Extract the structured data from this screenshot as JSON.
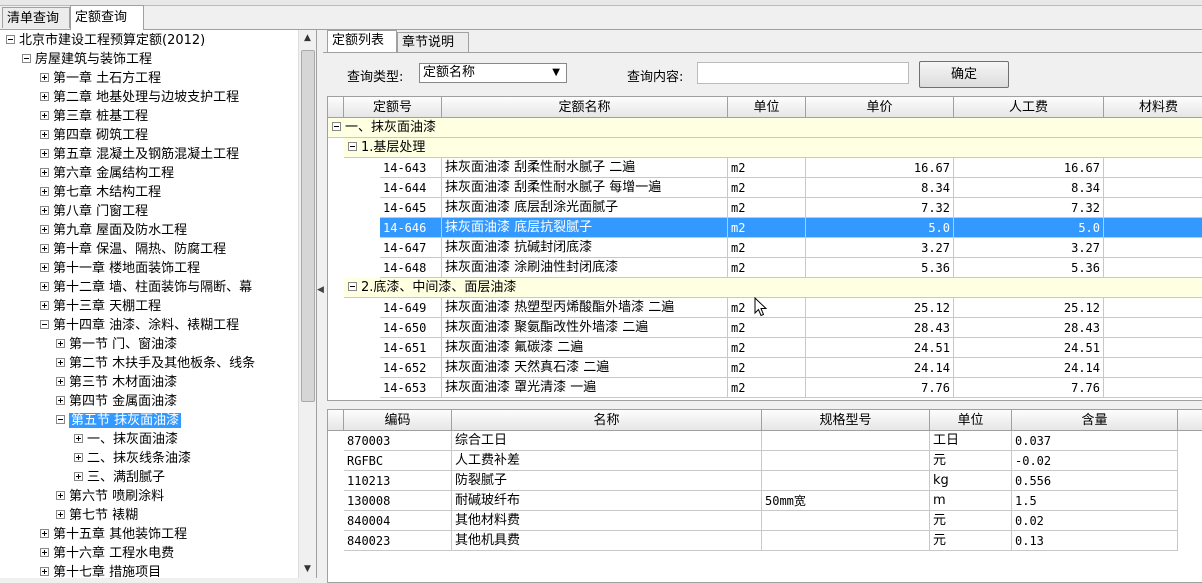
{
  "outer_tabs": [
    "清单查询",
    "定额查询"
  ],
  "tree": [
    {
      "label": "北京市建设工程预算定额(2012)",
      "level": 0,
      "state": "minus"
    },
    {
      "label": "房屋建筑与装饰工程",
      "level": 1,
      "state": "minus"
    },
    {
      "label": "第一章 土石方工程",
      "level": 2,
      "state": "plus"
    },
    {
      "label": "第二章 地基处理与边坡支护工程",
      "level": 2,
      "state": "plus"
    },
    {
      "label": "第三章 桩基工程",
      "level": 2,
      "state": "plus"
    },
    {
      "label": "第四章 砌筑工程",
      "level": 2,
      "state": "plus"
    },
    {
      "label": "第五章 混凝土及钢筋混凝土工程",
      "level": 2,
      "state": "plus"
    },
    {
      "label": "第六章 金属结构工程",
      "level": 2,
      "state": "plus"
    },
    {
      "label": "第七章 木结构工程",
      "level": 2,
      "state": "plus"
    },
    {
      "label": "第八章 门窗工程",
      "level": 2,
      "state": "plus"
    },
    {
      "label": "第九章 屋面及防水工程",
      "level": 2,
      "state": "plus"
    },
    {
      "label": "第十章 保温、隔热、防腐工程",
      "level": 2,
      "state": "plus"
    },
    {
      "label": "第十一章 楼地面装饰工程",
      "level": 2,
      "state": "plus"
    },
    {
      "label": "第十二章 墙、柱面装饰与隔断、幕",
      "level": 2,
      "state": "plus"
    },
    {
      "label": "第十三章 天棚工程",
      "level": 2,
      "state": "plus"
    },
    {
      "label": "第十四章 油漆、涂料、裱糊工程",
      "level": 2,
      "state": "minus"
    },
    {
      "label": "第一节 门、窗油漆",
      "level": 3,
      "state": "plus"
    },
    {
      "label": "第二节 木扶手及其他板条、线条",
      "level": 3,
      "state": "plus"
    },
    {
      "label": "第三节 木材面油漆",
      "level": 3,
      "state": "plus"
    },
    {
      "label": "第四节 金属面油漆",
      "level": 3,
      "state": "plus"
    },
    {
      "label": "第五节 抹灰面油漆",
      "level": 3,
      "state": "minus",
      "selected": true
    },
    {
      "label": "一、抹灰面油漆",
      "level": 4,
      "state": "plus"
    },
    {
      "label": "二、抹灰线条油漆",
      "level": 4,
      "state": "plus"
    },
    {
      "label": "三、满刮腻子",
      "level": 4,
      "state": "plus"
    },
    {
      "label": "第六节 喷刷涂料",
      "level": 3,
      "state": "plus"
    },
    {
      "label": "第七节 裱糊",
      "level": 3,
      "state": "plus"
    },
    {
      "label": "第十五章 其他装饰工程",
      "level": 2,
      "state": "plus"
    },
    {
      "label": "第十六章 工程水电费",
      "level": 2,
      "state": "plus"
    },
    {
      "label": "第十七章 措施项目",
      "level": 2,
      "state": "plus"
    }
  ],
  "inner_tabs": [
    "定额列表",
    "章节说明"
  ],
  "query": {
    "type_label": "查询类型:",
    "type_value": "定额名称",
    "content_label": "查询内容:",
    "content_value": "",
    "ok_label": "确定"
  },
  "quota_headers": [
    "定额号",
    "定额名称",
    "单位",
    "单价",
    "人工费",
    "材料费"
  ],
  "quota_root": "一、抹灰面油漆",
  "quota_groups": [
    {
      "label": "1.基层处理",
      "rows": [
        {
          "code": "14-643",
          "name": "抹灰面油漆 刮柔性耐水腻子 二遍",
          "unit": "m2",
          "price": "16.67",
          "labor": "16.67"
        },
        {
          "code": "14-644",
          "name": "抹灰面油漆 刮柔性耐水腻子 每增一遍",
          "unit": "m2",
          "price": "8.34",
          "labor": "8.34"
        },
        {
          "code": "14-645",
          "name": "抹灰面油漆 底层刮涂光面腻子",
          "unit": "m2",
          "price": "7.32",
          "labor": "7.32"
        },
        {
          "code": "14-646",
          "name": "抹灰面油漆 底层抗裂腻子",
          "unit": "m2",
          "price": "5.0",
          "labor": "5.0",
          "selected": true
        },
        {
          "code": "14-647",
          "name": "抹灰面油漆 抗碱封闭底漆",
          "unit": "m2",
          "price": "3.27",
          "labor": "3.27"
        },
        {
          "code": "14-648",
          "name": "抹灰面油漆 涂刷油性封闭底漆",
          "unit": "m2",
          "price": "5.36",
          "labor": "5.36"
        }
      ]
    },
    {
      "label": "2.底漆、中间漆、面层油漆",
      "rows": [
        {
          "code": "14-649",
          "name": "抹灰面油漆 热塑型丙烯酸酯外墙漆 二遍",
          "unit": "m2",
          "price": "25.12",
          "labor": "25.12"
        },
        {
          "code": "14-650",
          "name": "抹灰面油漆 聚氨酯改性外墙漆 二遍",
          "unit": "m2",
          "price": "28.43",
          "labor": "28.43"
        },
        {
          "code": "14-651",
          "name": "抹灰面油漆 氟碳漆 二遍",
          "unit": "m2",
          "price": "24.51",
          "labor": "24.51"
        },
        {
          "code": "14-652",
          "name": "抹灰面油漆 天然真石漆 二遍",
          "unit": "m2",
          "price": "24.14",
          "labor": "24.14"
        },
        {
          "code": "14-653",
          "name": "抹灰面油漆 罩光清漆 一遍",
          "unit": "m2",
          "price": "7.76",
          "labor": "7.76"
        }
      ]
    }
  ],
  "detail_headers": [
    "编码",
    "名称",
    "规格型号",
    "单位",
    "含量"
  ],
  "detail_rows": [
    {
      "code": "870003",
      "name": "综合工日",
      "spec": "",
      "unit": "工日",
      "qty": "0.037"
    },
    {
      "code": "RGFBC",
      "name": "人工费补差",
      "spec": "",
      "unit": "元",
      "qty": "-0.02"
    },
    {
      "code": "110213",
      "name": "防裂腻子",
      "spec": "",
      "unit": "kg",
      "qty": "0.556"
    },
    {
      "code": "130008",
      "name": "耐碱玻纤布",
      "spec": "50mm宽",
      "unit": "m",
      "qty": "1.5"
    },
    {
      "code": "840004",
      "name": "其他材料费",
      "spec": "",
      "unit": "元",
      "qty": "0.02"
    },
    {
      "code": "840023",
      "name": "其他机具费",
      "spec": "",
      "unit": "元",
      "qty": "0.13"
    }
  ],
  "colors": {
    "selection": "#3399ff",
    "group_bg": "#ffffe1"
  }
}
